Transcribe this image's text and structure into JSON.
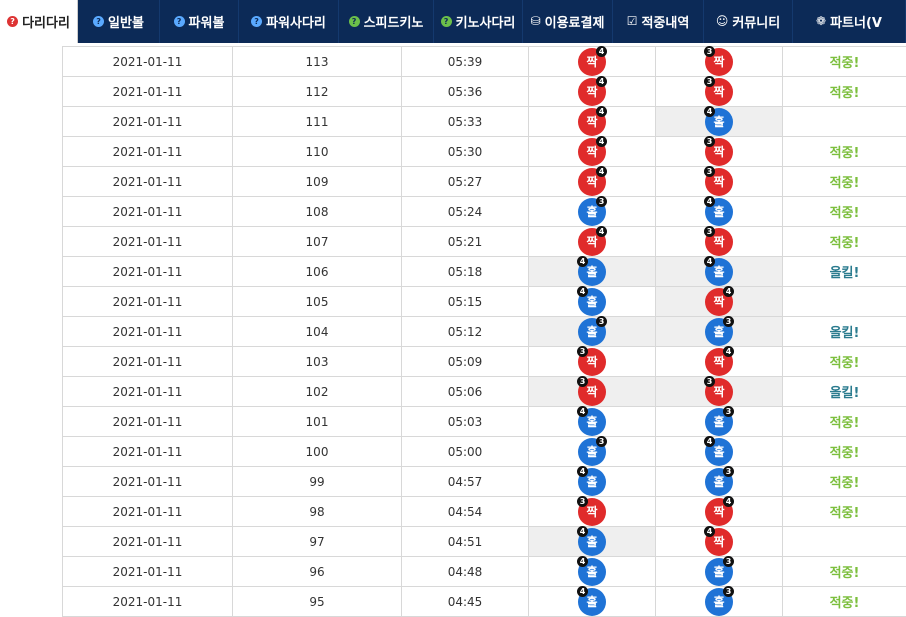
{
  "nav": [
    {
      "label": "다리다리",
      "icon": "question-icon",
      "active": true
    },
    {
      "label": "일반볼",
      "icon": "question-icon"
    },
    {
      "label": "파워볼",
      "icon": "question-icon"
    },
    {
      "label": "파워사다리",
      "icon": "question-icon"
    },
    {
      "label": "스피드키노",
      "icon": "question-icon"
    },
    {
      "label": "키노사다리",
      "icon": "question-icon"
    },
    {
      "label": "이용료결제",
      "icon": "database-icon"
    },
    {
      "label": "적중내역",
      "icon": "checkbox-icon"
    },
    {
      "label": "커뮤니티",
      "icon": "smile-icon"
    },
    {
      "label": "파트너(V",
      "icon": "partner-icon"
    }
  ],
  "rows": [
    {
      "date": "2021-01-11",
      "round": "113",
      "time": "05:39",
      "a": {
        "v": "짝",
        "n": "4",
        "c": "red",
        "p": "r"
      },
      "b": {
        "v": "짝",
        "n": "3",
        "c": "red",
        "p": "l"
      },
      "res": "적중!"
    },
    {
      "date": "2021-01-11",
      "round": "112",
      "time": "05:36",
      "a": {
        "v": "짝",
        "n": "4",
        "c": "red",
        "p": "r"
      },
      "b": {
        "v": "짝",
        "n": "3",
        "c": "red",
        "p": "l"
      },
      "res": "적중!"
    },
    {
      "date": "2021-01-11",
      "round": "111",
      "time": "05:33",
      "a": {
        "v": "짝",
        "n": "4",
        "c": "red",
        "p": "r"
      },
      "b": {
        "v": "홀",
        "n": "4",
        "c": "blue",
        "p": "l"
      },
      "bhl": true,
      "res": ""
    },
    {
      "date": "2021-01-11",
      "round": "110",
      "time": "05:30",
      "a": {
        "v": "짝",
        "n": "4",
        "c": "red",
        "p": "r"
      },
      "b": {
        "v": "짝",
        "n": "3",
        "c": "red",
        "p": "l"
      },
      "res": "적중!"
    },
    {
      "date": "2021-01-11",
      "round": "109",
      "time": "05:27",
      "a": {
        "v": "짝",
        "n": "4",
        "c": "red",
        "p": "r"
      },
      "b": {
        "v": "짝",
        "n": "3",
        "c": "red",
        "p": "l"
      },
      "res": "적중!"
    },
    {
      "date": "2021-01-11",
      "round": "108",
      "time": "05:24",
      "a": {
        "v": "홀",
        "n": "3",
        "c": "blue",
        "p": "r"
      },
      "b": {
        "v": "홀",
        "n": "4",
        "c": "blue",
        "p": "l"
      },
      "res": "적중!"
    },
    {
      "date": "2021-01-11",
      "round": "107",
      "time": "05:21",
      "a": {
        "v": "짝",
        "n": "4",
        "c": "red",
        "p": "r"
      },
      "b": {
        "v": "짝",
        "n": "3",
        "c": "red",
        "p": "l"
      },
      "res": "적중!"
    },
    {
      "date": "2021-01-11",
      "round": "106",
      "time": "05:18",
      "a": {
        "v": "홀",
        "n": "4",
        "c": "blue",
        "p": "l"
      },
      "b": {
        "v": "홀",
        "n": "4",
        "c": "blue",
        "p": "l"
      },
      "ahl": true,
      "bhl": true,
      "res": "올킬!",
      "all": true
    },
    {
      "date": "2021-01-11",
      "round": "105",
      "time": "05:15",
      "a": {
        "v": "홀",
        "n": "4",
        "c": "blue",
        "p": "l"
      },
      "b": {
        "v": "짝",
        "n": "4",
        "c": "red",
        "p": "r"
      },
      "bhl": true,
      "res": ""
    },
    {
      "date": "2021-01-11",
      "round": "104",
      "time": "05:12",
      "a": {
        "v": "홀",
        "n": "3",
        "c": "blue",
        "p": "r"
      },
      "b": {
        "v": "홀",
        "n": "3",
        "c": "blue",
        "p": "r"
      },
      "ahl": true,
      "bhl": true,
      "res": "올킬!",
      "all": true
    },
    {
      "date": "2021-01-11",
      "round": "103",
      "time": "05:09",
      "a": {
        "v": "짝",
        "n": "3",
        "c": "red",
        "p": "l"
      },
      "b": {
        "v": "짝",
        "n": "4",
        "c": "red",
        "p": "r"
      },
      "res": "적중!"
    },
    {
      "date": "2021-01-11",
      "round": "102",
      "time": "05:06",
      "a": {
        "v": "짝",
        "n": "3",
        "c": "red",
        "p": "l"
      },
      "b": {
        "v": "짝",
        "n": "3",
        "c": "red",
        "p": "l"
      },
      "ahl": true,
      "bhl": true,
      "res": "올킬!",
      "all": true
    },
    {
      "date": "2021-01-11",
      "round": "101",
      "time": "05:03",
      "a": {
        "v": "홀",
        "n": "4",
        "c": "blue",
        "p": "l"
      },
      "b": {
        "v": "홀",
        "n": "3",
        "c": "blue",
        "p": "r"
      },
      "res": "적중!"
    },
    {
      "date": "2021-01-11",
      "round": "100",
      "time": "05:00",
      "a": {
        "v": "홀",
        "n": "3",
        "c": "blue",
        "p": "r"
      },
      "b": {
        "v": "홀",
        "n": "4",
        "c": "blue",
        "p": "l"
      },
      "res": "적중!"
    },
    {
      "date": "2021-01-11",
      "round": "99",
      "time": "04:57",
      "a": {
        "v": "홀",
        "n": "4",
        "c": "blue",
        "p": "l"
      },
      "b": {
        "v": "홀",
        "n": "3",
        "c": "blue",
        "p": "r"
      },
      "res": "적중!"
    },
    {
      "date": "2021-01-11",
      "round": "98",
      "time": "04:54",
      "a": {
        "v": "짝",
        "n": "3",
        "c": "red",
        "p": "l"
      },
      "b": {
        "v": "짝",
        "n": "4",
        "c": "red",
        "p": "r"
      },
      "res": "적중!"
    },
    {
      "date": "2021-01-11",
      "round": "97",
      "time": "04:51",
      "a": {
        "v": "홀",
        "n": "4",
        "c": "blue",
        "p": "l"
      },
      "b": {
        "v": "짝",
        "n": "4",
        "c": "red",
        "p": "l"
      },
      "ahl": true,
      "res": ""
    },
    {
      "date": "2021-01-11",
      "round": "96",
      "time": "04:48",
      "a": {
        "v": "홀",
        "n": "4",
        "c": "blue",
        "p": "l"
      },
      "b": {
        "v": "홀",
        "n": "3",
        "c": "blue",
        "p": "r"
      },
      "res": "적중!"
    },
    {
      "date": "2021-01-11",
      "round": "95",
      "time": "04:45",
      "a": {
        "v": "홀",
        "n": "4",
        "c": "blue",
        "p": "l"
      },
      "b": {
        "v": "홀",
        "n": "3",
        "c": "blue",
        "p": "r"
      },
      "res": "적중!"
    }
  ]
}
